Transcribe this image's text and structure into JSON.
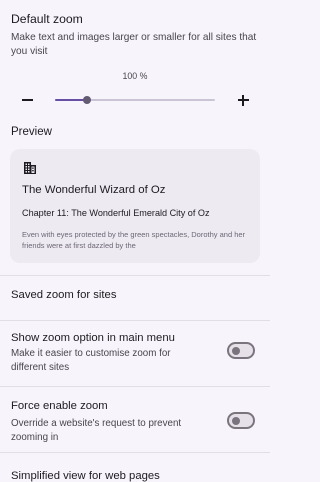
{
  "default_zoom": {
    "title": "Default zoom",
    "description": "Make text and images larger or smaller for all sites that you visit",
    "value_label": "100 %",
    "slider_fraction": 0.2,
    "decrease_icon": "minus-icon",
    "increase_icon": "plus-icon"
  },
  "preview": {
    "label": "Preview",
    "icon": "building-icon",
    "title": "The Wonderful Wizard of Oz",
    "chapter": "Chapter 11: The Wonderful Emerald City of Oz",
    "body": "Even with eyes protected by the green spectacles, Dorothy and her friends were at first dazzled by the"
  },
  "settings": {
    "saved_zoom": {
      "title": "Saved zoom for sites"
    },
    "show_zoom_option": {
      "title": "Show zoom option in main menu",
      "description": "Make it easier to customise zoom for different sites",
      "enabled": false
    },
    "force_enable_zoom": {
      "title": "Force enable zoom",
      "description": "Override a website's request to prevent zooming in",
      "enabled": false
    },
    "simplified_view": {
      "title": "Simplified view for web pages"
    }
  },
  "colors": {
    "background": "#f8f4fb",
    "accent": "#6750a4",
    "card": "#eeeaf2"
  }
}
